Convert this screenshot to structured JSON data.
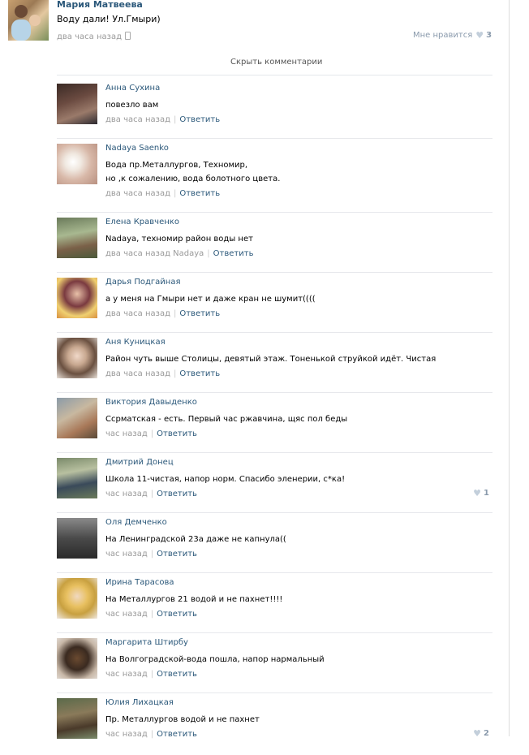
{
  "post": {
    "author": "Мария Матвеева",
    "text": "Воду дали! Ул.Гмыри)",
    "time": "два часа назад",
    "likes_label": "Мне нравится",
    "likes_count": "3"
  },
  "hide_comments": "Скрыть комментарии",
  "reply_label": "Ответить",
  "comments": [
    {
      "author": "Анна Сухина",
      "lines": [
        "повезло вам"
      ],
      "time": "два часа назад",
      "likes": ""
    },
    {
      "author": "Nadaya Saenko",
      "lines": [
        "Вода пр.Металлургов, Техномир,",
        "но ,к сожалению, вода болотного цвета."
      ],
      "time": "два часа назад",
      "likes": ""
    },
    {
      "author": "Елена Кравченко",
      "lines": [
        "Nadaya, техномир район воды нет"
      ],
      "time": "два часа назад Nadaya",
      "likes": ""
    },
    {
      "author": "Дарья Подгайная",
      "lines": [
        "а у меня на Гмыри нет и даже кран не шумит(((("
      ],
      "time": "два часа назад",
      "likes": ""
    },
    {
      "author": "Аня Куницкая",
      "lines": [
        "Район чуть выше Столицы, девятый этаж. Тоненькой струйкой идёт. Чистая"
      ],
      "time": "два часа назад",
      "likes": ""
    },
    {
      "author": "Виктория Давыденко",
      "lines": [
        "Ссрматская - есть. Первый час ржавчина, щяс пол беды"
      ],
      "time": "час назад",
      "likes": ""
    },
    {
      "author": "Дмитрий Донец",
      "lines": [
        "Школа 11-чистая, напор норм. Спасибо эленерии, с*ка!"
      ],
      "time": "час назад",
      "likes": "1"
    },
    {
      "author": "Оля Демченко",
      "lines": [
        "На Ленинградской 23а даже не капнула(("
      ],
      "time": "час назад",
      "likes": ""
    },
    {
      "author": "Ирина Тарасова",
      "lines": [
        "На Металлургов 21 водой и не пахнет!!!!"
      ],
      "time": "час назад",
      "likes": ""
    },
    {
      "author": "Маргарита Штирбу",
      "lines": [
        "На Волгоградской-вода пошла, напор нармальный"
      ],
      "time": "час назад",
      "likes": ""
    },
    {
      "author": "Юлия Лихацкая",
      "lines": [
        "Пр. Металлургов водой и не пахнет"
      ],
      "time": "час назад",
      "likes": "2"
    }
  ],
  "colors": {
    "link": "#2b587a",
    "meta": "#999999",
    "divider": "#e7e8ec",
    "heart": "#c3cfdb"
  }
}
